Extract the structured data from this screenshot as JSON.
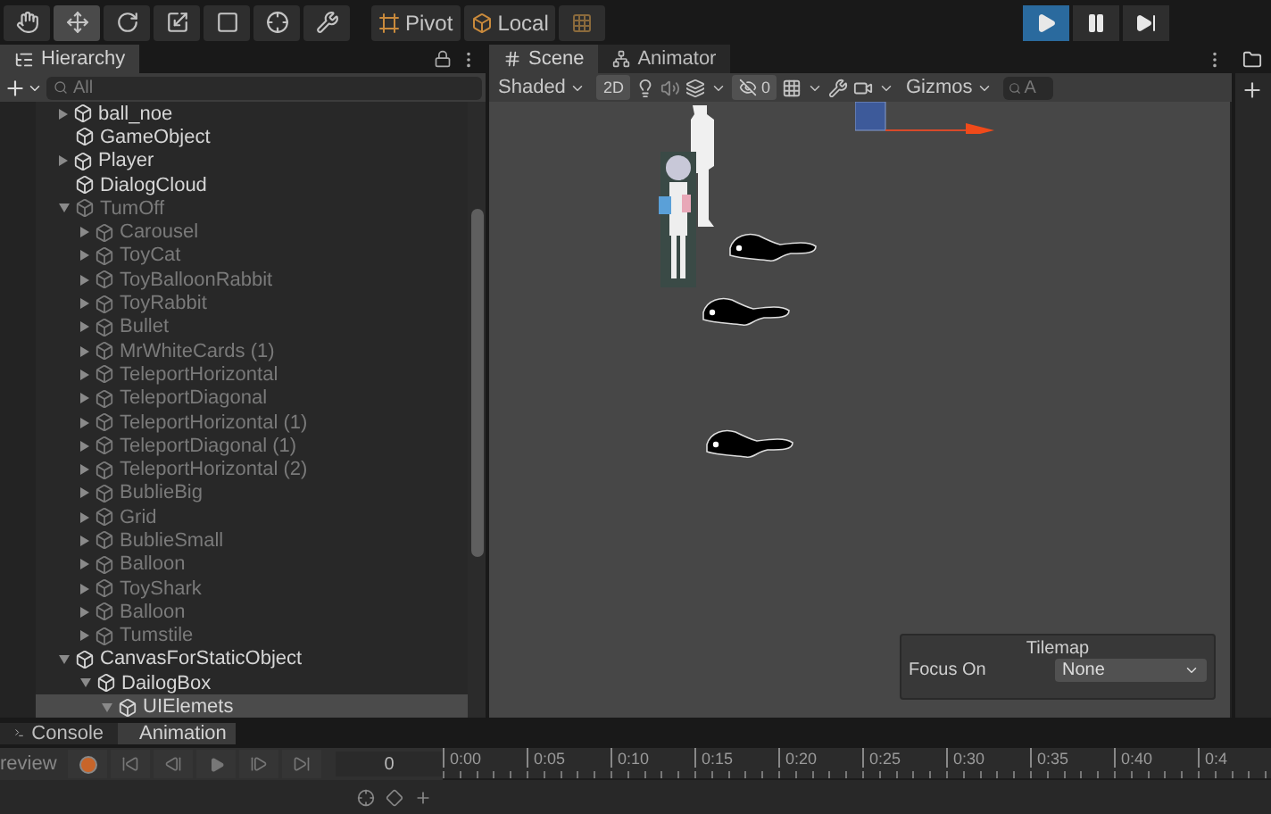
{
  "toolbar": {
    "tools": [
      {
        "kind": "hand",
        "selected": false
      },
      {
        "kind": "move",
        "selected": true
      },
      {
        "kind": "rotate",
        "selected": false
      },
      {
        "kind": "scale",
        "selected": false
      },
      {
        "kind": "rect",
        "selected": false
      },
      {
        "kind": "transform",
        "selected": false
      },
      {
        "kind": "custom",
        "selected": false
      }
    ],
    "pivot": "Pivot",
    "space": "Local",
    "play_controls": [
      {
        "kind": "play",
        "selected": true
      },
      {
        "kind": "pause",
        "selected": false
      },
      {
        "kind": "step",
        "selected": false
      }
    ]
  },
  "hierarchy": {
    "title": "Hierarchy",
    "search": {
      "placeholder": "All"
    },
    "items": [
      {
        "name": "ball_noe",
        "expanded": false,
        "disabled": false,
        "selected": false
      },
      {
        "name": "GameObject",
        "disabled": false,
        "selected": false
      },
      {
        "name": "Player",
        "expanded": false,
        "disabled": false,
        "selected": false
      },
      {
        "name": "DialogCloud",
        "disabled": false,
        "selected": false
      },
      {
        "name": "TumOff",
        "expanded": true,
        "disabled": true,
        "selected": false,
        "children": [
          {
            "name": "Carousel",
            "expanded": false,
            "disabled": true,
            "selected": false
          },
          {
            "name": "ToyCat",
            "expanded": false,
            "disabled": true,
            "selected": false
          },
          {
            "name": "ToyBalloonRabbit",
            "expanded": false,
            "disabled": true,
            "selected": false
          },
          {
            "name": "ToyRabbit",
            "expanded": false,
            "disabled": true,
            "selected": false
          },
          {
            "name": "Bullet",
            "expanded": false,
            "disabled": true,
            "selected": false
          },
          {
            "name": "MrWhiteCards (1)",
            "expanded": false,
            "disabled": true,
            "selected": false
          },
          {
            "name": "TeleportHorizontal",
            "expanded": false,
            "disabled": true,
            "selected": false
          },
          {
            "name": "TeleportDiagonal",
            "expanded": false,
            "disabled": true,
            "selected": false
          },
          {
            "name": "TeleportHorizontal (1)",
            "expanded": false,
            "disabled": true,
            "selected": false
          },
          {
            "name": "TeleportDiagonal (1)",
            "expanded": false,
            "disabled": true,
            "selected": false
          },
          {
            "name": "TeleportHorizontal (2)",
            "expanded": false,
            "disabled": true,
            "selected": false
          },
          {
            "name": "BublieBig",
            "expanded": false,
            "disabled": true,
            "selected": false
          },
          {
            "name": "Grid",
            "expanded": false,
            "disabled": true,
            "selected": false
          },
          {
            "name": "BublieSmall",
            "expanded": false,
            "disabled": true,
            "selected": false
          },
          {
            "name": "Balloon",
            "expanded": false,
            "disabled": true,
            "selected": false
          },
          {
            "name": "ToyShark",
            "expanded": false,
            "disabled": true,
            "selected": false
          },
          {
            "name": "Balloon",
            "expanded": false,
            "disabled": true,
            "selected": false
          },
          {
            "name": "Tumstile",
            "expanded": false,
            "disabled": true,
            "selected": false
          }
        ]
      },
      {
        "name": "CanvasForStaticObject",
        "expanded": true,
        "disabled": false,
        "selected": false,
        "children": [
          {
            "name": "DailogBox",
            "expanded": true,
            "disabled": false,
            "selected": false,
            "children": [
              {
                "name": "UIElemets",
                "expanded": true,
                "disabled": false,
                "selected": true
              }
            ]
          }
        ]
      }
    ]
  },
  "scene": {
    "tabs": [
      {
        "label": "Scene",
        "kind": "scene",
        "selected": true
      },
      {
        "label": "Animator",
        "kind": "animator",
        "selected": false
      }
    ],
    "shading": "Shaded",
    "mode_2d": {
      "label": "2D",
      "on": true
    },
    "hidden_count": "0",
    "gizmos": "Gizmos",
    "search": {
      "placeholder": "A"
    },
    "tilemap": {
      "title": "Tilemap",
      "label": "Focus On",
      "value": "None"
    }
  },
  "bottom": {
    "tabs": [
      {
        "label": "Console",
        "kind": "console",
        "selected": false
      },
      {
        "label": "Animation",
        "kind": "animation",
        "selected": true
      }
    ],
    "preview": "review",
    "frame": "0",
    "ruler": [
      "0:00",
      "0:05",
      "0:10",
      "0:15",
      "0:20",
      "0:25",
      "0:30",
      "0:35",
      "0:40",
      "0:4"
    ]
  }
}
